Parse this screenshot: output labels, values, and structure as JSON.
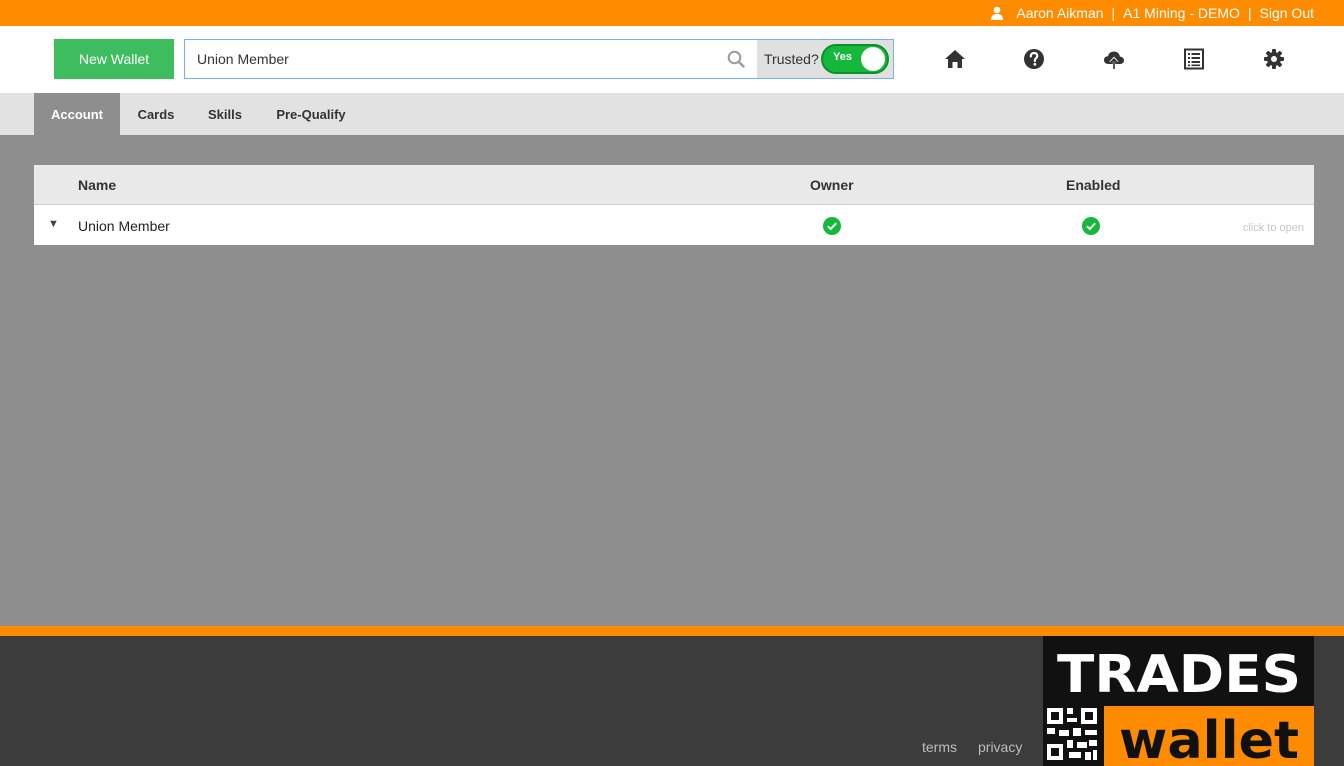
{
  "topbar": {
    "user_name": "Aaron Aikman",
    "separator": "|",
    "company": "A1 Mining - DEMO",
    "sign_out": "Sign Out",
    "color": "#ff8c00"
  },
  "header": {
    "new_wallet_label": "New Wallet",
    "search_value": "Union Member",
    "trusted_label": "Trusted?",
    "toggle_label": "Yes",
    "toggle_on": true
  },
  "icons": [
    "home-icon",
    "help-icon",
    "cloud-upload-icon",
    "list-icon",
    "gear-icon"
  ],
  "tabs": [
    {
      "label": "Account",
      "active": true
    },
    {
      "label": "Cards",
      "active": false
    },
    {
      "label": "Skills",
      "active": false
    },
    {
      "label": "Pre-Qualify",
      "active": false
    }
  ],
  "table": {
    "columns": [
      "Name",
      "Owner",
      "Enabled"
    ],
    "rows": [
      {
        "name": "Union Member",
        "owner": true,
        "enabled": true,
        "hint": "click to open"
      }
    ]
  },
  "footer": {
    "terms": "terms",
    "privacy": "privacy",
    "logo_top": "TRADES",
    "logo_bottom": "wallet"
  }
}
